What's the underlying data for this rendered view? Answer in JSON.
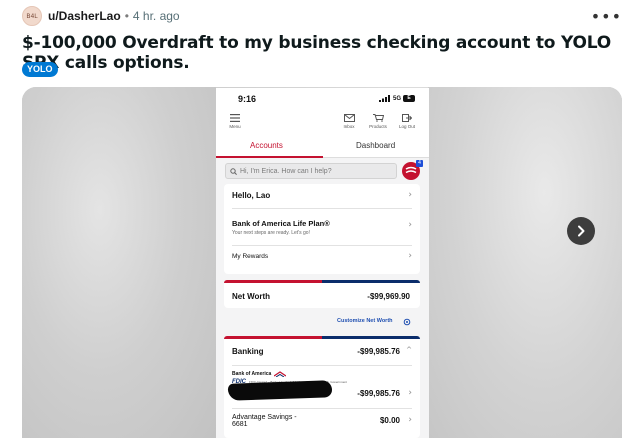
{
  "post": {
    "avatar_text": "B4L",
    "author": "u/DasherLao",
    "separator": "•",
    "time": "4 hr. ago",
    "more_label": "•••",
    "title": "$-100,000 Overdraft to my business checking account to YOLO SPX calls options.",
    "flair": "YOLO"
  },
  "colors": {
    "flair": "#0079d3",
    "boa_red": "#c41230",
    "boa_blue": "#0b2d6b",
    "link_blue": "#1f4fb1"
  },
  "phone": {
    "status_time": "9:16",
    "signal": "5G",
    "battery": "E",
    "nav": {
      "menu": "Menu",
      "inbox": "Inbox",
      "products": "Products",
      "logout": "Log Out"
    },
    "tabs": {
      "accounts": "Accounts",
      "dashboard": "Dashboard"
    },
    "search_placeholder": "Hi, I'm Erica. How can I help?",
    "erica_badge": "4",
    "chevron": "›",
    "greeting": "Hello, Lao",
    "life_plan": {
      "title": "Bank of America Life Plan®",
      "subtitle": "Your next steps are ready.  Let's go!"
    },
    "rewards": "My Rewards",
    "net_worth": {
      "label": "Net Worth",
      "value": "-$99,969.90"
    },
    "customize": "Customize Net Worth",
    "banking": {
      "label": "Banking",
      "value": "-$99,985.76",
      "toggle": "^"
    },
    "bank_name": "Bank of America",
    "fdic": "FDIC",
    "fdic_note": "FDIC-Insured – Backed by the full faith and credit of the U.S. Government",
    "account_value": "-$99,985.76",
    "savings": {
      "label": "Advantage Savings -",
      "number": "6681",
      "value": "$0.00"
    }
  }
}
